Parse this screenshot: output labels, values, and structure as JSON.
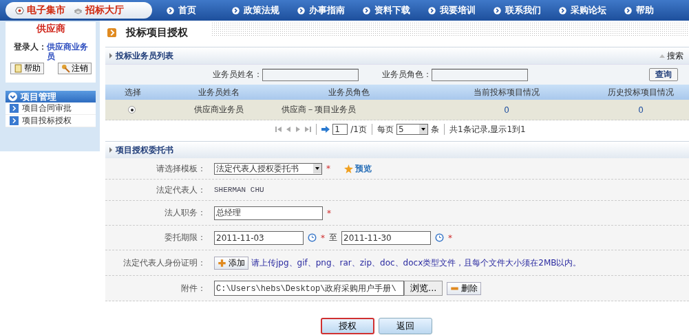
{
  "header": {
    "brand_tabs": [
      "电子集市",
      "招标大厅"
    ],
    "nav": [
      "首页",
      "政策法规",
      "办事指南",
      "资料下载",
      "我要培训",
      "联系我们",
      "采购论坛",
      "帮助"
    ]
  },
  "sidebar": {
    "role": "供应商",
    "login_label": "登录人：",
    "login_user": "供应商业务员",
    "buttons": [
      "帮助",
      "注销"
    ],
    "menu": {
      "title": "项目管理",
      "expanded": true,
      "items": [
        "项目合同审批",
        "项目投标授权"
      ]
    }
  },
  "page_title": "投标项目授权",
  "list_panel": {
    "title": "投标业务员列表",
    "search_toggle": "搜索",
    "filters": [
      {
        "label": "业务员姓名："
      },
      {
        "label": "业务员角色："
      }
    ],
    "query_button": "查询",
    "columns": [
      "选择",
      "业务员姓名",
      "业务员角色",
      "当前投标项目情况",
      "历史投标项目情况"
    ],
    "rows": [
      {
        "selected": true,
        "name": "供应商业务员",
        "role": "供应商－项目业务员",
        "current": "0",
        "history": "0"
      }
    ],
    "pager": {
      "page": "1",
      "total": "/1页",
      "per_page_label": "每页",
      "per_page": "5",
      "unit": "条",
      "summary": "共1条记录,显示1到1"
    }
  },
  "form_panel": {
    "title": "项目授权委托书",
    "rows": [
      {
        "kind": "select",
        "label": "请选择模板：",
        "value": "法定代表人授权委托书",
        "mark": "*",
        "link": "预览"
      },
      {
        "kind": "text",
        "label": "法定代表人：",
        "value": "SHERMAN CHU"
      },
      {
        "kind": "input",
        "label": "法人职务：",
        "value": "总经理",
        "mark": "*"
      },
      {
        "kind": "date_range",
        "label": "委托期限：",
        "from": "2011-11-03",
        "from_mark": "*",
        "to_label": "至",
        "to": "2011-11-30",
        "to_mark": "*"
      },
      {
        "kind": "upload",
        "label": "法定代表人身份证明：",
        "button": "添加",
        "hint": "请上传jpg、gif、png、rar、zip、doc、docx类型文件，且每个文件大小须在2MB以内。"
      },
      {
        "kind": "file",
        "label": "附件：",
        "value": "C:\\Users\\hebs\\Desktop\\政府采购用户手册\\",
        "browse": "浏览...",
        "remove": "删除"
      }
    ]
  },
  "actions": [
    {
      "label": "授权",
      "focused": true
    },
    {
      "label": "返回",
      "focused": false
    }
  ]
}
